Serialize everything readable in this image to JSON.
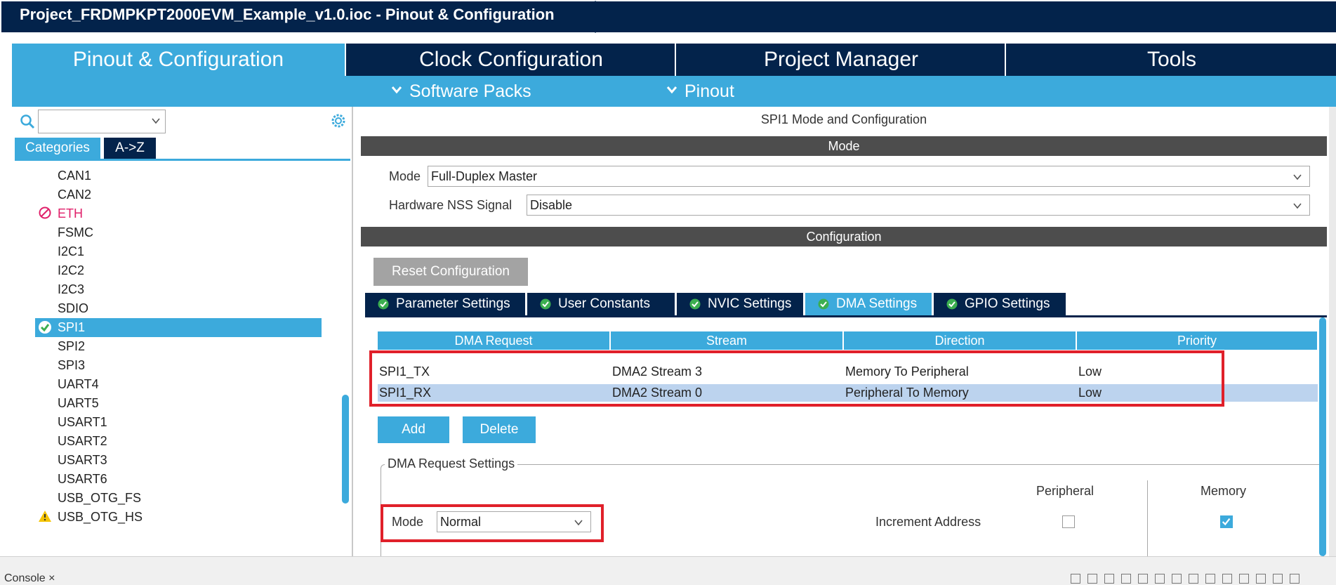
{
  "window": {
    "title": "Project_FRDMPKPT2000EVM_Example_v1.0.ioc - Pinout & Configuration"
  },
  "main_tabs": [
    {
      "label": "Pinout & Configuration",
      "active": true
    },
    {
      "label": "Clock Configuration",
      "active": false
    },
    {
      "label": "Project Manager",
      "active": false
    },
    {
      "label": "Tools",
      "active": false
    }
  ],
  "sub_menu": [
    {
      "label": "Software Packs",
      "icon": "chevron-down-icon"
    },
    {
      "label": "Pinout",
      "icon": "chevron-down-icon"
    }
  ],
  "left_panel": {
    "search": {
      "value": "",
      "icon": "search-icon"
    },
    "settings_icon": "gear-icon",
    "tabs": [
      {
        "label": "Categories",
        "active": true
      },
      {
        "label": "A->Z",
        "active": false
      }
    ],
    "peripherals": [
      {
        "label": "CAN1",
        "status": "none"
      },
      {
        "label": "CAN2",
        "status": "none"
      },
      {
        "label": "ETH",
        "status": "disabled"
      },
      {
        "label": "FSMC",
        "status": "none"
      },
      {
        "label": "I2C1",
        "status": "none"
      },
      {
        "label": "I2C2",
        "status": "none"
      },
      {
        "label": "I2C3",
        "status": "none"
      },
      {
        "label": "SDIO",
        "status": "none"
      },
      {
        "label": "SPI1",
        "status": "configured",
        "selected": true
      },
      {
        "label": "SPI2",
        "status": "none"
      },
      {
        "label": "SPI3",
        "status": "none"
      },
      {
        "label": "UART4",
        "status": "none"
      },
      {
        "label": "UART5",
        "status": "none"
      },
      {
        "label": "USART1",
        "status": "none"
      },
      {
        "label": "USART2",
        "status": "none"
      },
      {
        "label": "USART3",
        "status": "none"
      },
      {
        "label": "USART6",
        "status": "none"
      },
      {
        "label": "USB_OTG_FS",
        "status": "none"
      },
      {
        "label": "USB_OTG_HS",
        "status": "warning"
      }
    ]
  },
  "right_panel": {
    "title": "SPI1 Mode and Configuration",
    "mode_header": "Mode",
    "mode_fields": [
      {
        "label": "Mode",
        "value": "Full-Duplex Master"
      },
      {
        "label": "Hardware NSS Signal",
        "value": "Disable"
      }
    ],
    "config_header": "Configuration",
    "reset_button": "Reset Configuration",
    "config_tabs": [
      {
        "label": "Parameter Settings",
        "active": false
      },
      {
        "label": "User Constants",
        "active": false
      },
      {
        "label": "NVIC Settings",
        "active": false
      },
      {
        "label": "DMA Settings",
        "active": true
      },
      {
        "label": "GPIO Settings",
        "active": false
      }
    ],
    "dma_table": {
      "columns": [
        "DMA Request",
        "Stream",
        "Direction",
        "Priority"
      ],
      "rows": [
        [
          "SPI1_TX",
          "DMA2 Stream 3",
          "Memory To Peripheral",
          "Low"
        ],
        [
          "SPI1_RX",
          "DMA2 Stream 0",
          "Peripheral To Memory",
          "Low"
        ]
      ],
      "selected_row": 1
    },
    "add_button": "Add",
    "delete_button": "Delete",
    "dma_request_settings": {
      "legend": "DMA Request Settings",
      "col_peripheral": "Peripheral",
      "col_memory": "Memory",
      "mode_label": "Mode",
      "mode_value": "Normal",
      "increment_label": "Increment Address",
      "peripheral_checked": false,
      "memory_checked": true
    }
  },
  "bottom": {
    "console_label": "Console ×"
  },
  "colors": {
    "navy": "#03234b",
    "accent": "#3caadc",
    "highlight": "#e0202a",
    "selected_row": "#bcd3ee"
  }
}
